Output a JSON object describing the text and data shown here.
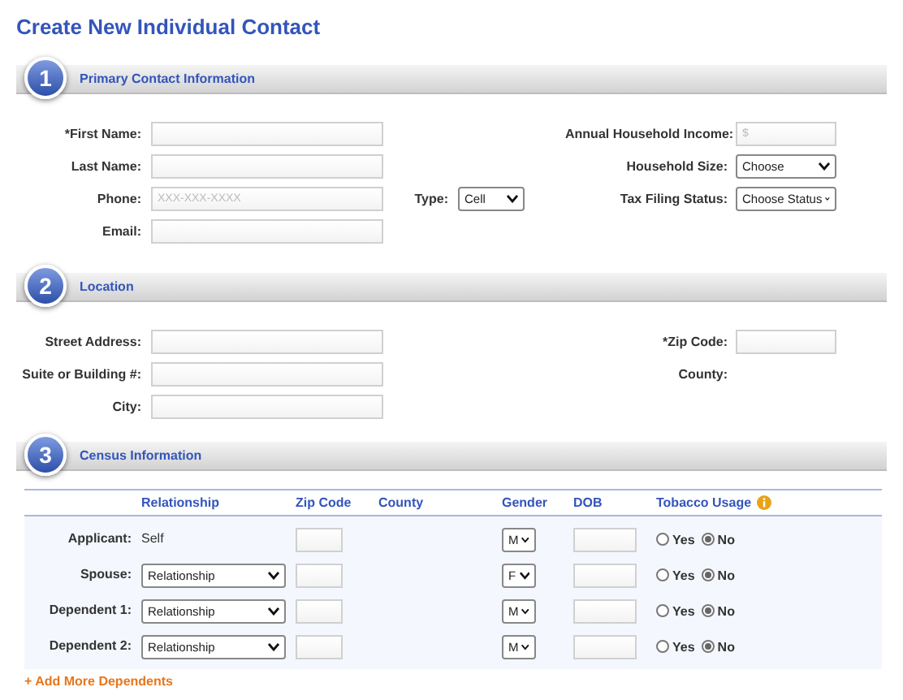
{
  "title": "Create New Individual Contact",
  "primary_contact": {
    "number": "1",
    "title": "Primary Contact Information",
    "left_fields": [
      {
        "label": "*First Name:"
      },
      {
        "label": "Last Name:"
      },
      {
        "label": "Phone:",
        "placeholder": "XXX-XXX-XXXX"
      },
      {
        "label": "Email:"
      }
    ],
    "type_field": {
      "label": "Type:",
      "value": "Cell"
    },
    "right_fields": [
      {
        "label": "Annual Household Income:",
        "kind": "input",
        "placeholder": "$"
      },
      {
        "label": "Household Size:",
        "kind": "select",
        "value": "Choose"
      },
      {
        "label": "Tax Filing Status:",
        "kind": "select",
        "value": "Choose Status"
      }
    ]
  },
  "location": {
    "number": "2",
    "title": "Location",
    "left_fields": [
      {
        "label": "Street Address:"
      },
      {
        "label": "Suite or Building #:"
      },
      {
        "label": "City:"
      }
    ],
    "right_fields": [
      {
        "label": "*Zip Code:",
        "kind": "input"
      },
      {
        "label": "County:",
        "kind": "text"
      }
    ]
  },
  "census": {
    "number": "3",
    "title": "Census Information",
    "columns": [
      "Relationship",
      "Zip Code",
      "County",
      "Gender",
      "DOB",
      "Tobacco Usage"
    ],
    "rows": [
      {
        "label": "Applicant:",
        "relationship": {
          "kind": "text",
          "value": "Self"
        },
        "gender": "M",
        "tobacco": [
          {
            "label": "Yes",
            "selected": false
          },
          {
            "label": "No",
            "selected": true
          }
        ]
      },
      {
        "label": "Spouse:",
        "relationship": {
          "kind": "select",
          "value": "Relationship"
        },
        "gender": "F",
        "tobacco": [
          {
            "label": "Yes",
            "selected": false
          },
          {
            "label": "No",
            "selected": true
          }
        ]
      },
      {
        "label": "Dependent 1:",
        "relationship": {
          "kind": "select",
          "value": "Relationship"
        },
        "gender": "M",
        "tobacco": [
          {
            "label": "Yes",
            "selected": false
          },
          {
            "label": "No",
            "selected": true
          }
        ]
      },
      {
        "label": "Dependent 2:",
        "relationship": {
          "kind": "select",
          "value": "Relationship"
        },
        "gender": "M",
        "tobacco": [
          {
            "label": "Yes",
            "selected": false
          },
          {
            "label": "No",
            "selected": true
          }
        ]
      }
    ],
    "add_link": "+ Add More Dependents"
  }
}
